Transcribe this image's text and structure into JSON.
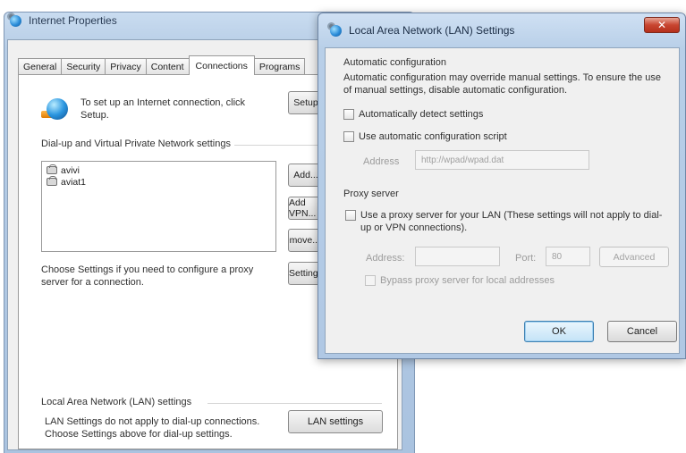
{
  "internet_properties": {
    "title": "Internet Properties",
    "tabs": [
      "General",
      "Security",
      "Privacy",
      "Content",
      "Connections",
      "Programs"
    ],
    "active_tab": "Connections",
    "setup_text": "To set up an Internet connection, click Setup.",
    "setup_button": "Setup",
    "vpn_group_label": "Dial-up and Virtual Private Network settings",
    "vpn_connections": [
      "avivi",
      "aviat1"
    ],
    "add_button": "Add...",
    "add_vpn_button": "Add VPN...",
    "remove_button": "Remove...",
    "settings_button": "Settings",
    "choose_text": "Choose Settings if you need to configure a proxy server for a connection.",
    "lan_group_label": "Local Area Network (LAN) settings",
    "lan_text": "LAN Settings do not apply to dial-up connections. Choose Settings above for dial-up settings.",
    "lan_settings_button": "LAN settings"
  },
  "lan_dialog": {
    "title": "Local Area Network (LAN) Settings",
    "close_label": "✕",
    "auto_config": {
      "label": "Automatic configuration",
      "description": "Automatic configuration may override manual settings. To ensure the use of manual settings, disable automatic configuration.",
      "auto_detect_label": "Automatically detect settings",
      "auto_script_label": "Use automatic configuration script",
      "address_label": "Address",
      "address_value": "http://wpad/wpad.dat"
    },
    "proxy": {
      "label": "Proxy server",
      "use_proxy_label": "Use a proxy server for your LAN (These settings will not apply to dial-up or VPN connections).",
      "address_label": "Address:",
      "address_value": "",
      "port_label": "Port:",
      "port_value": "80",
      "advanced_button": "Advanced",
      "bypass_label": "Bypass proxy server for local addresses"
    },
    "ok_button": "OK",
    "cancel_button": "Cancel"
  }
}
